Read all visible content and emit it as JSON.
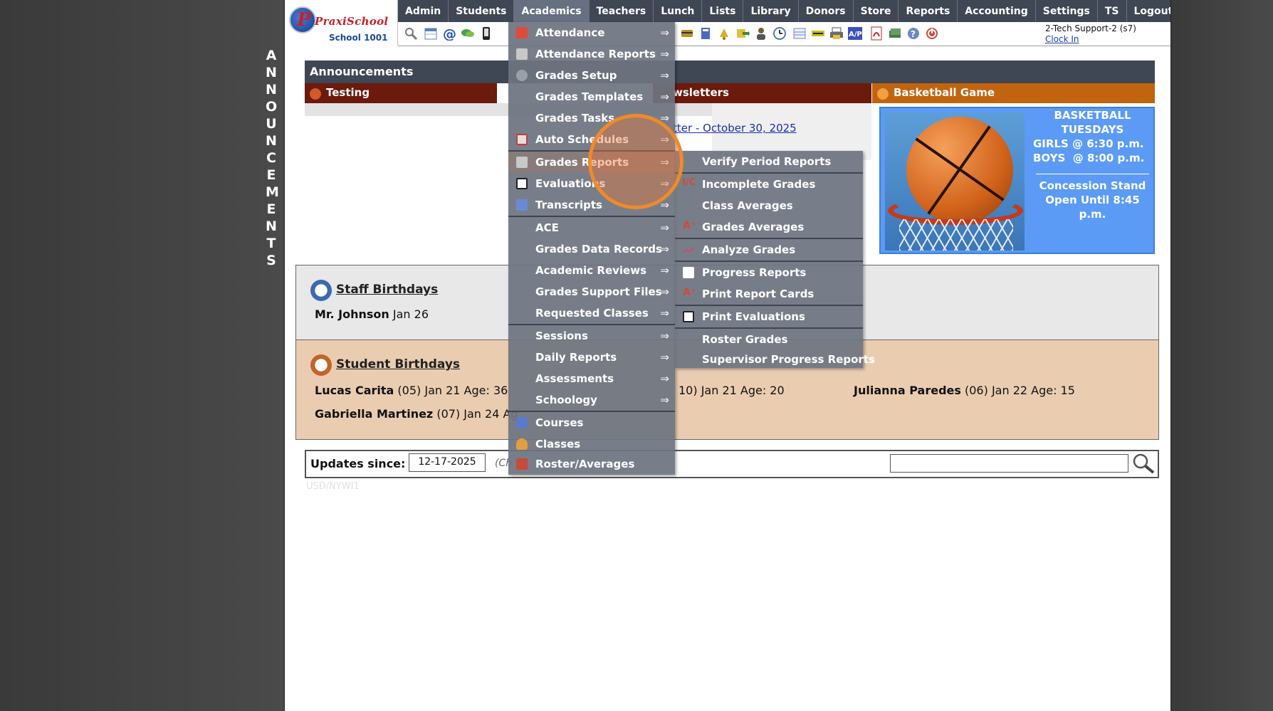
{
  "header": {
    "logo_text": "PraxiSchool",
    "school_name": "School 1001",
    "user": "2-Tech Support-2 (s7)",
    "clock_in": "Clock In"
  },
  "nav": [
    "Admin",
    "Students",
    "Academics",
    "Teachers",
    "Lunch",
    "Lists",
    "Library",
    "Donors",
    "Store",
    "Reports",
    "Accounting",
    "Settings",
    "TS",
    "Logout"
  ],
  "vertical_label": "ANNOUNCEMENTS",
  "announcements": {
    "title": "Announcements",
    "testing": "Testing",
    "newsletters_partial": "wsletters",
    "newsletter_link_partial": "tter - October 30, 2025",
    "basketball_title": "Basketball Game",
    "basketball_lines": [
      "BASKETBALL",
      "TUESDAYS",
      "GIRLS @ 6:30 p.m.",
      "BOYS  @ 8:00 p.m.",
      "Concession Stand",
      "Open Until 8:45 p.m."
    ]
  },
  "staff_birthdays": {
    "title": "Staff Birthdays",
    "people": [
      {
        "name": "Mr. Johnson",
        "detail": " Jan 26"
      }
    ]
  },
  "student_birthdays": {
    "title": "Student Birthdays",
    "people": [
      {
        "name": "Lucas Carita",
        "detail": " (05) Jan 21 Age: 36"
      },
      {
        "name": "",
        "detail": "10) Jan 21 Age: 20"
      },
      {
        "name": "Julianna Paredes",
        "detail": " (06) Jan 22 Age: 15"
      },
      {
        "name": "Gabriella Martinez",
        "detail": " (07) Jan 24 Ag"
      }
    ]
  },
  "updates": {
    "label": "Updates since:",
    "date_value": "12-17-2025",
    "hint": "(Ch"
  },
  "menu_academics": [
    {
      "label": "Attendance",
      "arrow": "⇒",
      "icon": "calendar-icon"
    },
    {
      "label": "Attendance Reports",
      "arrow": "⇒",
      "icon": "printer-icon"
    },
    {
      "label": "Grades Setup",
      "arrow": "⇒",
      "icon": "gear-icon"
    },
    {
      "label": "Grades Templates",
      "arrow": "⇒",
      "icon": ""
    },
    {
      "label": "Grades Tasks",
      "arrow": "⇒",
      "icon": ""
    },
    {
      "label": "Auto Schedules",
      "arrow": "⇒",
      "icon": "schedule-icon"
    },
    {
      "label": "Grades Reports",
      "arrow": "⇒",
      "icon": "printer-icon"
    },
    {
      "label": "Evaluations",
      "arrow": "⇒",
      "icon": "checkbox-icon"
    },
    {
      "label": "Transcripts",
      "arrow": "⇒",
      "icon": "document-icon"
    },
    {
      "label": "ACE",
      "arrow": "⇒",
      "icon": ""
    },
    {
      "label": "Grades Data Records",
      "arrow": "⇒",
      "icon": ""
    },
    {
      "label": "Academic Reviews",
      "arrow": "⇒",
      "icon": ""
    },
    {
      "label": "Grades Support Files",
      "arrow": "⇒",
      "icon": ""
    },
    {
      "label": "Requested Classes",
      "arrow": "⇒",
      "icon": ""
    },
    {
      "label": "Sessions",
      "arrow": "⇒",
      "icon": ""
    },
    {
      "label": "Daily Reports",
      "arrow": "⇒",
      "icon": ""
    },
    {
      "label": "Assessments",
      "arrow": "⇒",
      "icon": ""
    },
    {
      "label": "Schoology",
      "arrow": "⇒",
      "icon": ""
    },
    {
      "label": "Courses",
      "arrow": "",
      "icon": "book-icon"
    },
    {
      "label": "Classes",
      "arrow": "",
      "icon": "person-icon"
    },
    {
      "label": "Roster/Averages",
      "arrow": "",
      "icon": "roster-icon"
    }
  ],
  "menu_grades_reports": [
    {
      "label": "Verify Period Reports",
      "icon": ""
    },
    {
      "label": "Incomplete Grades",
      "icon": "ic-icon"
    },
    {
      "label": "Class Averages",
      "icon": ""
    },
    {
      "label": "Grades Averages",
      "icon": "a-plus-icon"
    },
    {
      "label": "Analyze Grades",
      "icon": "chart-icon"
    },
    {
      "label": "Progress Reports",
      "icon": "page-icon"
    },
    {
      "label": "Print Report Cards",
      "icon": "a-plus-icon"
    },
    {
      "label": "Print Evaluations",
      "icon": "checkbox-icon"
    },
    {
      "label": "Roster Grades",
      "icon": ""
    },
    {
      "label": "Supervisor Progress Reports",
      "icon": ""
    }
  ],
  "faint_text": "USD/NYWI1"
}
